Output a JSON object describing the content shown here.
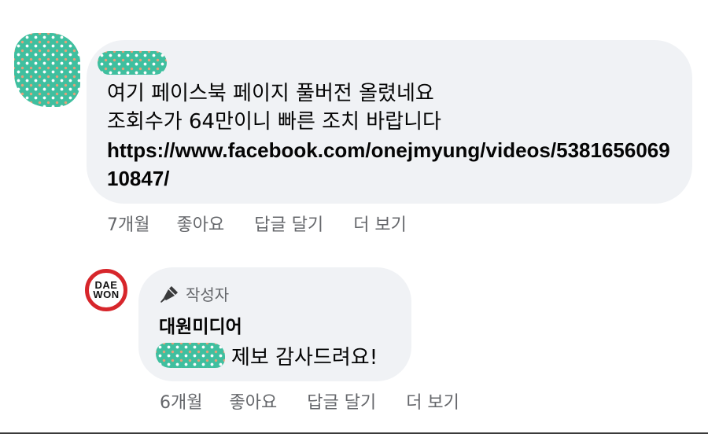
{
  "comment": {
    "text_lines": "여기 페이스북 페이지 풀버전 올렸네요\n조회수가 64만이니 빠른 조치 바랍니다",
    "link": "https://www.facebook.com/onejmyung/videos/538165606910847/",
    "actions": {
      "time": "7개월",
      "like": "좋아요",
      "reply": "답글 달기",
      "more": "더 보기"
    }
  },
  "reply": {
    "avatar_text_line1": "DAE",
    "avatar_text_line2": "WON",
    "author_badge": "작성자",
    "author_name": "대원미디어",
    "text": "제보 감사드려요!",
    "actions": {
      "time": "6개월",
      "like": "좋아요",
      "reply": "답글 달기",
      "more": "더 보기"
    }
  },
  "colors": {
    "bubble": "#f0f2f5",
    "secondary_text": "#65676b",
    "logo_ring": "#d7262b",
    "blur_teal": "#3fbf9f"
  }
}
